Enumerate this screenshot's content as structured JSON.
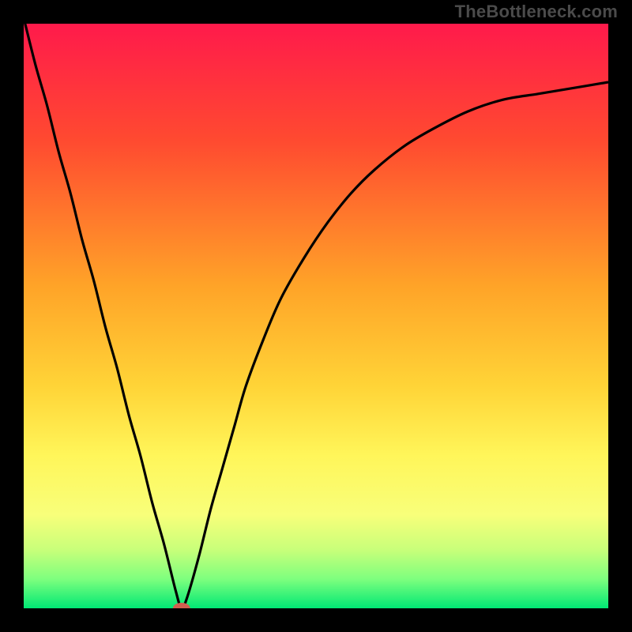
{
  "watermark": "TheBottleneck.com",
  "chart_data": {
    "type": "line",
    "title": "",
    "xlabel": "",
    "ylabel": "",
    "xlim": [
      0,
      100
    ],
    "ylim": [
      0,
      100
    ],
    "gradient_stops": [
      {
        "offset": 0,
        "color": "#ff1a4b"
      },
      {
        "offset": 20,
        "color": "#ff4a30"
      },
      {
        "offset": 45,
        "color": "#ffa428"
      },
      {
        "offset": 62,
        "color": "#ffd437"
      },
      {
        "offset": 74,
        "color": "#fff65a"
      },
      {
        "offset": 84,
        "color": "#f8ff7a"
      },
      {
        "offset": 90,
        "color": "#c8ff7a"
      },
      {
        "offset": 95,
        "color": "#7eff7e"
      },
      {
        "offset": 100,
        "color": "#00e874"
      }
    ],
    "series": [
      {
        "name": "bottleneck-curve",
        "x": [
          0,
          2,
          4,
          6,
          8,
          10,
          12,
          14,
          16,
          18,
          20,
          22,
          24,
          26,
          27,
          28,
          30,
          32,
          34,
          36,
          38,
          41,
          44,
          48,
          52,
          56,
          60,
          65,
          70,
          76,
          82,
          88,
          94,
          100
        ],
        "y": [
          101,
          93,
          86,
          78,
          71,
          63,
          56,
          48,
          41,
          33,
          26,
          18,
          11,
          3,
          0,
          2,
          9,
          17,
          24,
          31,
          38,
          46,
          53,
          60,
          66,
          71,
          75,
          79,
          82,
          85,
          87,
          88,
          89,
          90
        ]
      }
    ],
    "marker": {
      "x": 27,
      "y": 0,
      "color": "#d1604f"
    }
  }
}
